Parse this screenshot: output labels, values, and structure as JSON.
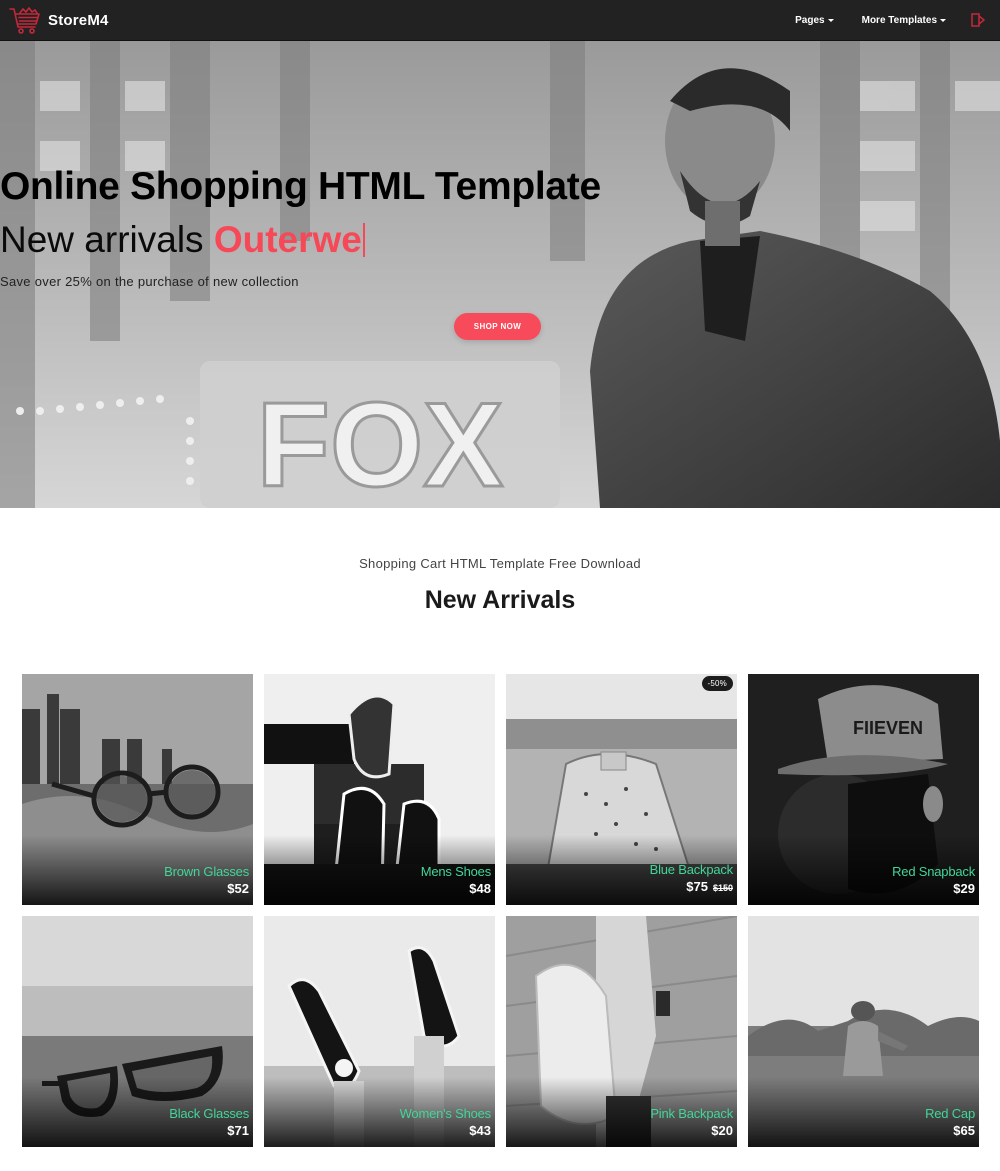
{
  "navbar": {
    "brand": "StoreM4",
    "logo_icon": "shopping-cart-icon",
    "links": [
      {
        "label": "Pages",
        "icon": "caret-down-icon"
      },
      {
        "label": "More Templates",
        "icon": "caret-down-icon"
      }
    ],
    "exit_icon": "sign-out-icon"
  },
  "hero": {
    "title": "Online Shopping HTML Template",
    "subtitle_prefix": "New arrivals ",
    "subtitle_accent": "Outerwe",
    "description": "Save over 25% on the purchase of new collection",
    "cta_label": "SHOP NOW"
  },
  "section": {
    "kicker": "Shopping Cart HTML Template Free Download",
    "title": "New Arrivals"
  },
  "products": [
    {
      "name": "Brown Glasses",
      "price": "$52"
    },
    {
      "name": "Mens Shoes",
      "price": "$48"
    },
    {
      "name": "Blue Backpack",
      "price": "$75",
      "old_price": "$150",
      "badge": "-50%"
    },
    {
      "name": "Red Snapback",
      "price": "$29"
    },
    {
      "name": "Black Glasses",
      "price": "$71"
    },
    {
      "name": "Women's Shoes",
      "price": "$43"
    },
    {
      "name": "Pink Backpack",
      "price": "$20"
    },
    {
      "name": "Red Cap",
      "price": "$65"
    }
  ],
  "colors": {
    "accent": "#f74a5a",
    "product_name": "#41d69a",
    "navbar_bg": "#222222"
  }
}
